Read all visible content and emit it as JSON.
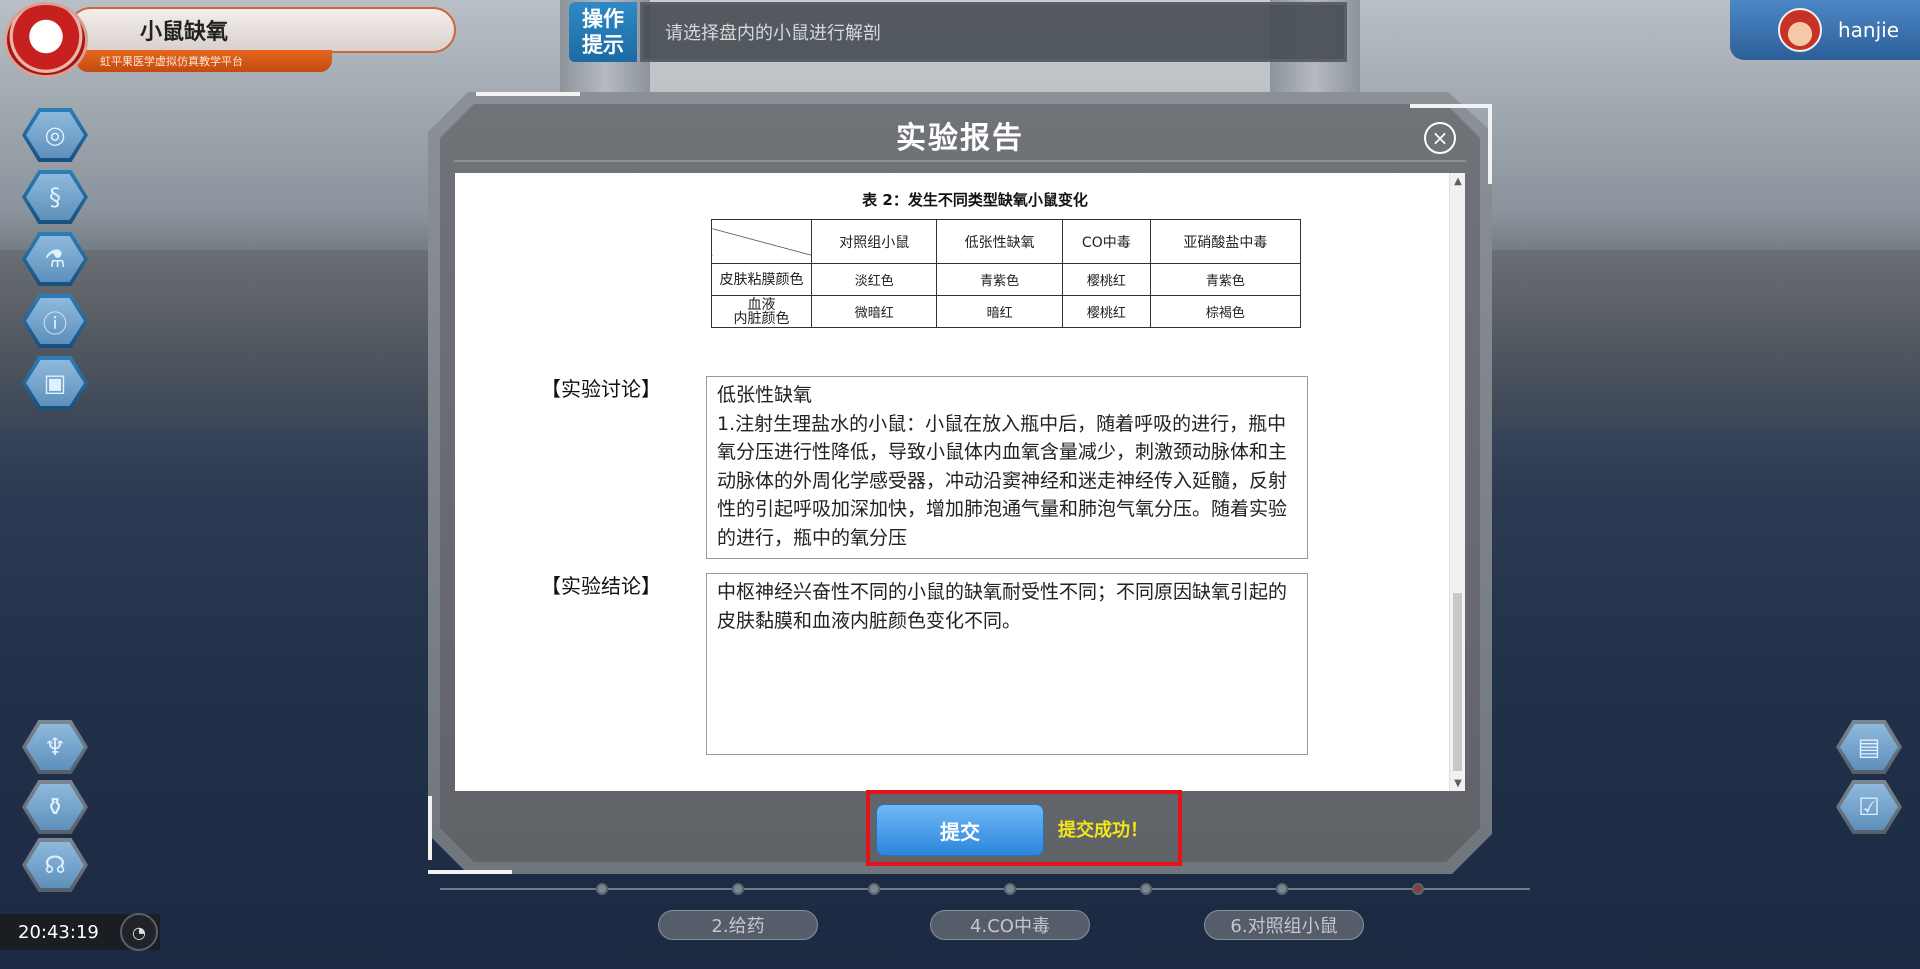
{
  "app": {
    "title": "小鼠缺氧",
    "subtitle": "虹平果医学虚拟仿真教学平台"
  },
  "hint": {
    "label_line1": "操作",
    "label_line2": "提示",
    "text": "请选择盘内的小鼠进行解剖"
  },
  "user": {
    "name": "hanjie"
  },
  "left_toolbar": {
    "icons": [
      "target-icon",
      "dna-icon",
      "flask-icon",
      "info-icon",
      "document-icon"
    ]
  },
  "bottom_left_toolbar": {
    "icons": [
      "microscope-icon",
      "bottle-icon",
      "hand-care-icon"
    ]
  },
  "right_toolbar": {
    "icons": [
      "chart-icon",
      "clipboard-check-icon"
    ]
  },
  "clock": {
    "time": "20:43:19"
  },
  "steps": {
    "labels": [
      "2.给药",
      "4.CO中毒",
      "6.对照组小鼠"
    ]
  },
  "modal": {
    "title": "实验报告",
    "close": "×",
    "table_title": "表 2：发生不同类型缺氧小鼠变化",
    "table": {
      "headers": [
        "对照组小鼠",
        "低张性缺氧",
        "CO中毒",
        "亚硝酸盐中毒"
      ],
      "rows": [
        {
          "label": "皮肤粘膜颜色",
          "cells": [
            "淡红色",
            "青紫色",
            "樱桃红",
            "青紫色"
          ]
        },
        {
          "label_line1": "血液",
          "label_line2": "内脏颜色",
          "cells": [
            "微暗红",
            "暗红",
            "樱桃红",
            "棕褐色"
          ]
        }
      ]
    },
    "discussion_label": "【实验讨论】",
    "discussion_text": "低张性缺氧\n1.注射生理盐水的小鼠：小鼠在放入瓶中后，随着呼吸的进行，瓶中氧分压进行性降低，导致小鼠体内血氧含量减少，刺激颈动脉体和主动脉体的外周化学感受器，冲动沿窦神经和迷走神经传入延髓，反射性的引起呼吸加深加快，增加肺泡通气量和肺泡气氧分压。随着实验的进行，瓶中的氧分压",
    "conclusion_label": "【实验结论】",
    "conclusion_text": "中枢神经兴奋性不同的小鼠的缺氧耐受性不同；不同原因缺氧引起的皮肤黏膜和血液内脏颜色变化不同。",
    "submit_label": "提交",
    "submit_status": "提交成功！"
  }
}
